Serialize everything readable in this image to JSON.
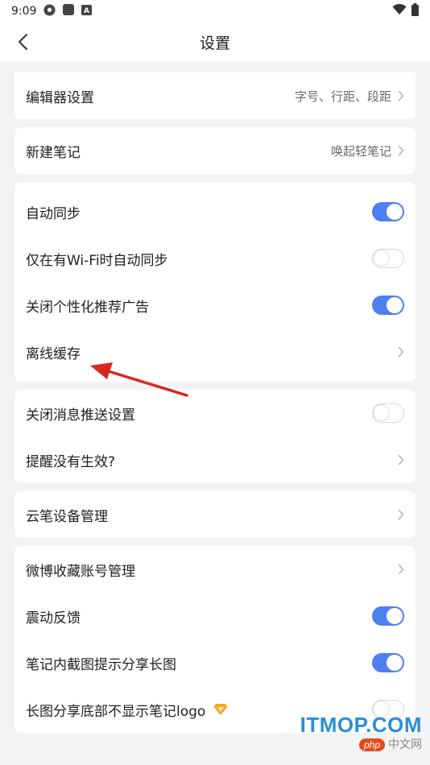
{
  "status_bar": {
    "time": "9:09",
    "icons": [
      "soccer-ball-icon",
      "square-app-icon",
      "a-letter-icon",
      "wifi-icon",
      "battery-icon"
    ],
    "letter_icon_text": "A"
  },
  "header": {
    "title": "设置",
    "back_icon": "chevron-left-icon"
  },
  "groups": {
    "editor": {
      "label": "编辑器设置",
      "value": "字号、行距、段距"
    },
    "new_note": {
      "label": "新建笔记",
      "value": "唤起轻笔记"
    },
    "sync": {
      "auto_sync": {
        "label": "自动同步",
        "on": true
      },
      "wifi_sync": {
        "label": "仅在有Wi-Fi时自动同步",
        "on": false
      },
      "ads": {
        "label": "关闭个性化推荐广告",
        "on": true
      },
      "offline_cache": {
        "label": "离线缓存"
      }
    },
    "notifications": {
      "push": {
        "label": "关闭消息推送设置",
        "on": false
      },
      "reminder": {
        "label": "提醒没有生效?"
      }
    },
    "pen": {
      "label": "云笔设备管理"
    },
    "misc": {
      "weibo": {
        "label": "微博收藏账号管理"
      },
      "vibration": {
        "label": "震动反馈",
        "on": true
      },
      "screenshot_share": {
        "label": "笔记内截图提示分享长图",
        "on": true
      },
      "logo": {
        "label": "长图分享底部不显示笔记logo",
        "on": false,
        "badge_icon": "vip-diamond-icon"
      }
    }
  },
  "colors": {
    "accent": "#4e7ff0",
    "background": "#f2f3f5",
    "arrow": "#d9261c",
    "watermark": "#2a8fd8"
  },
  "watermark": {
    "main": "ITMOP.COM",
    "php": "php",
    "sub": "中文网"
  }
}
